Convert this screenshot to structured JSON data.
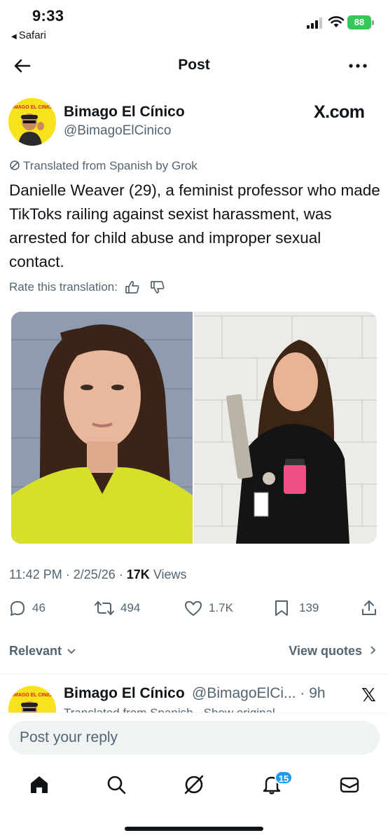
{
  "status_bar": {
    "time": "9:33",
    "back_app": "Safari",
    "battery": "88"
  },
  "nav": {
    "title": "Post"
  },
  "post": {
    "author_name": "Bimago El Cínico",
    "author_handle": "@BimagoElCinico",
    "source_label": "X.com",
    "avatar_text": "BIMAGO EL CINICO",
    "translated_note": "Translated from Spanish by Grok",
    "text": "Danielle Weaver (29), a feminist professor who made TikToks railing against sexist harassment, was arrested for child abuse and improper sexual contact.",
    "rate_label": "Rate this translation:",
    "time": "11:42 PM",
    "date": "2/25/26",
    "views_count": "17K",
    "views_label": "Views"
  },
  "actions": {
    "replies": "46",
    "reposts": "494",
    "likes": "1.7K",
    "bookmarks": "139"
  },
  "sort": {
    "relevant_label": "Relevant",
    "view_quotes_label": "View quotes"
  },
  "reply_preview": {
    "name": "Bimago El Cínico",
    "handle_time": "@BimagoElCi... · 9h",
    "sub_text": "Translated from Spanish · Show original"
  },
  "composer": {
    "placeholder": "Post your reply"
  },
  "tabbar": {
    "notifications_badge": "15"
  },
  "colors": {
    "accent": "#1d9bf0",
    "secondary_text": "#536471",
    "battery_green": "#34c759",
    "avatar_yellow": "#f7e21b"
  },
  "icons": [
    "back-arrow-icon",
    "more-icon",
    "x-logo-icon",
    "translate-icon",
    "thumbs-up-icon",
    "thumbs-down-icon",
    "reply-icon",
    "repost-icon",
    "like-icon",
    "bookmark-icon",
    "share-icon",
    "chevron-down-icon",
    "chevron-right-icon",
    "home-icon",
    "search-icon",
    "grok-icon",
    "notifications-icon",
    "messages-icon"
  ]
}
